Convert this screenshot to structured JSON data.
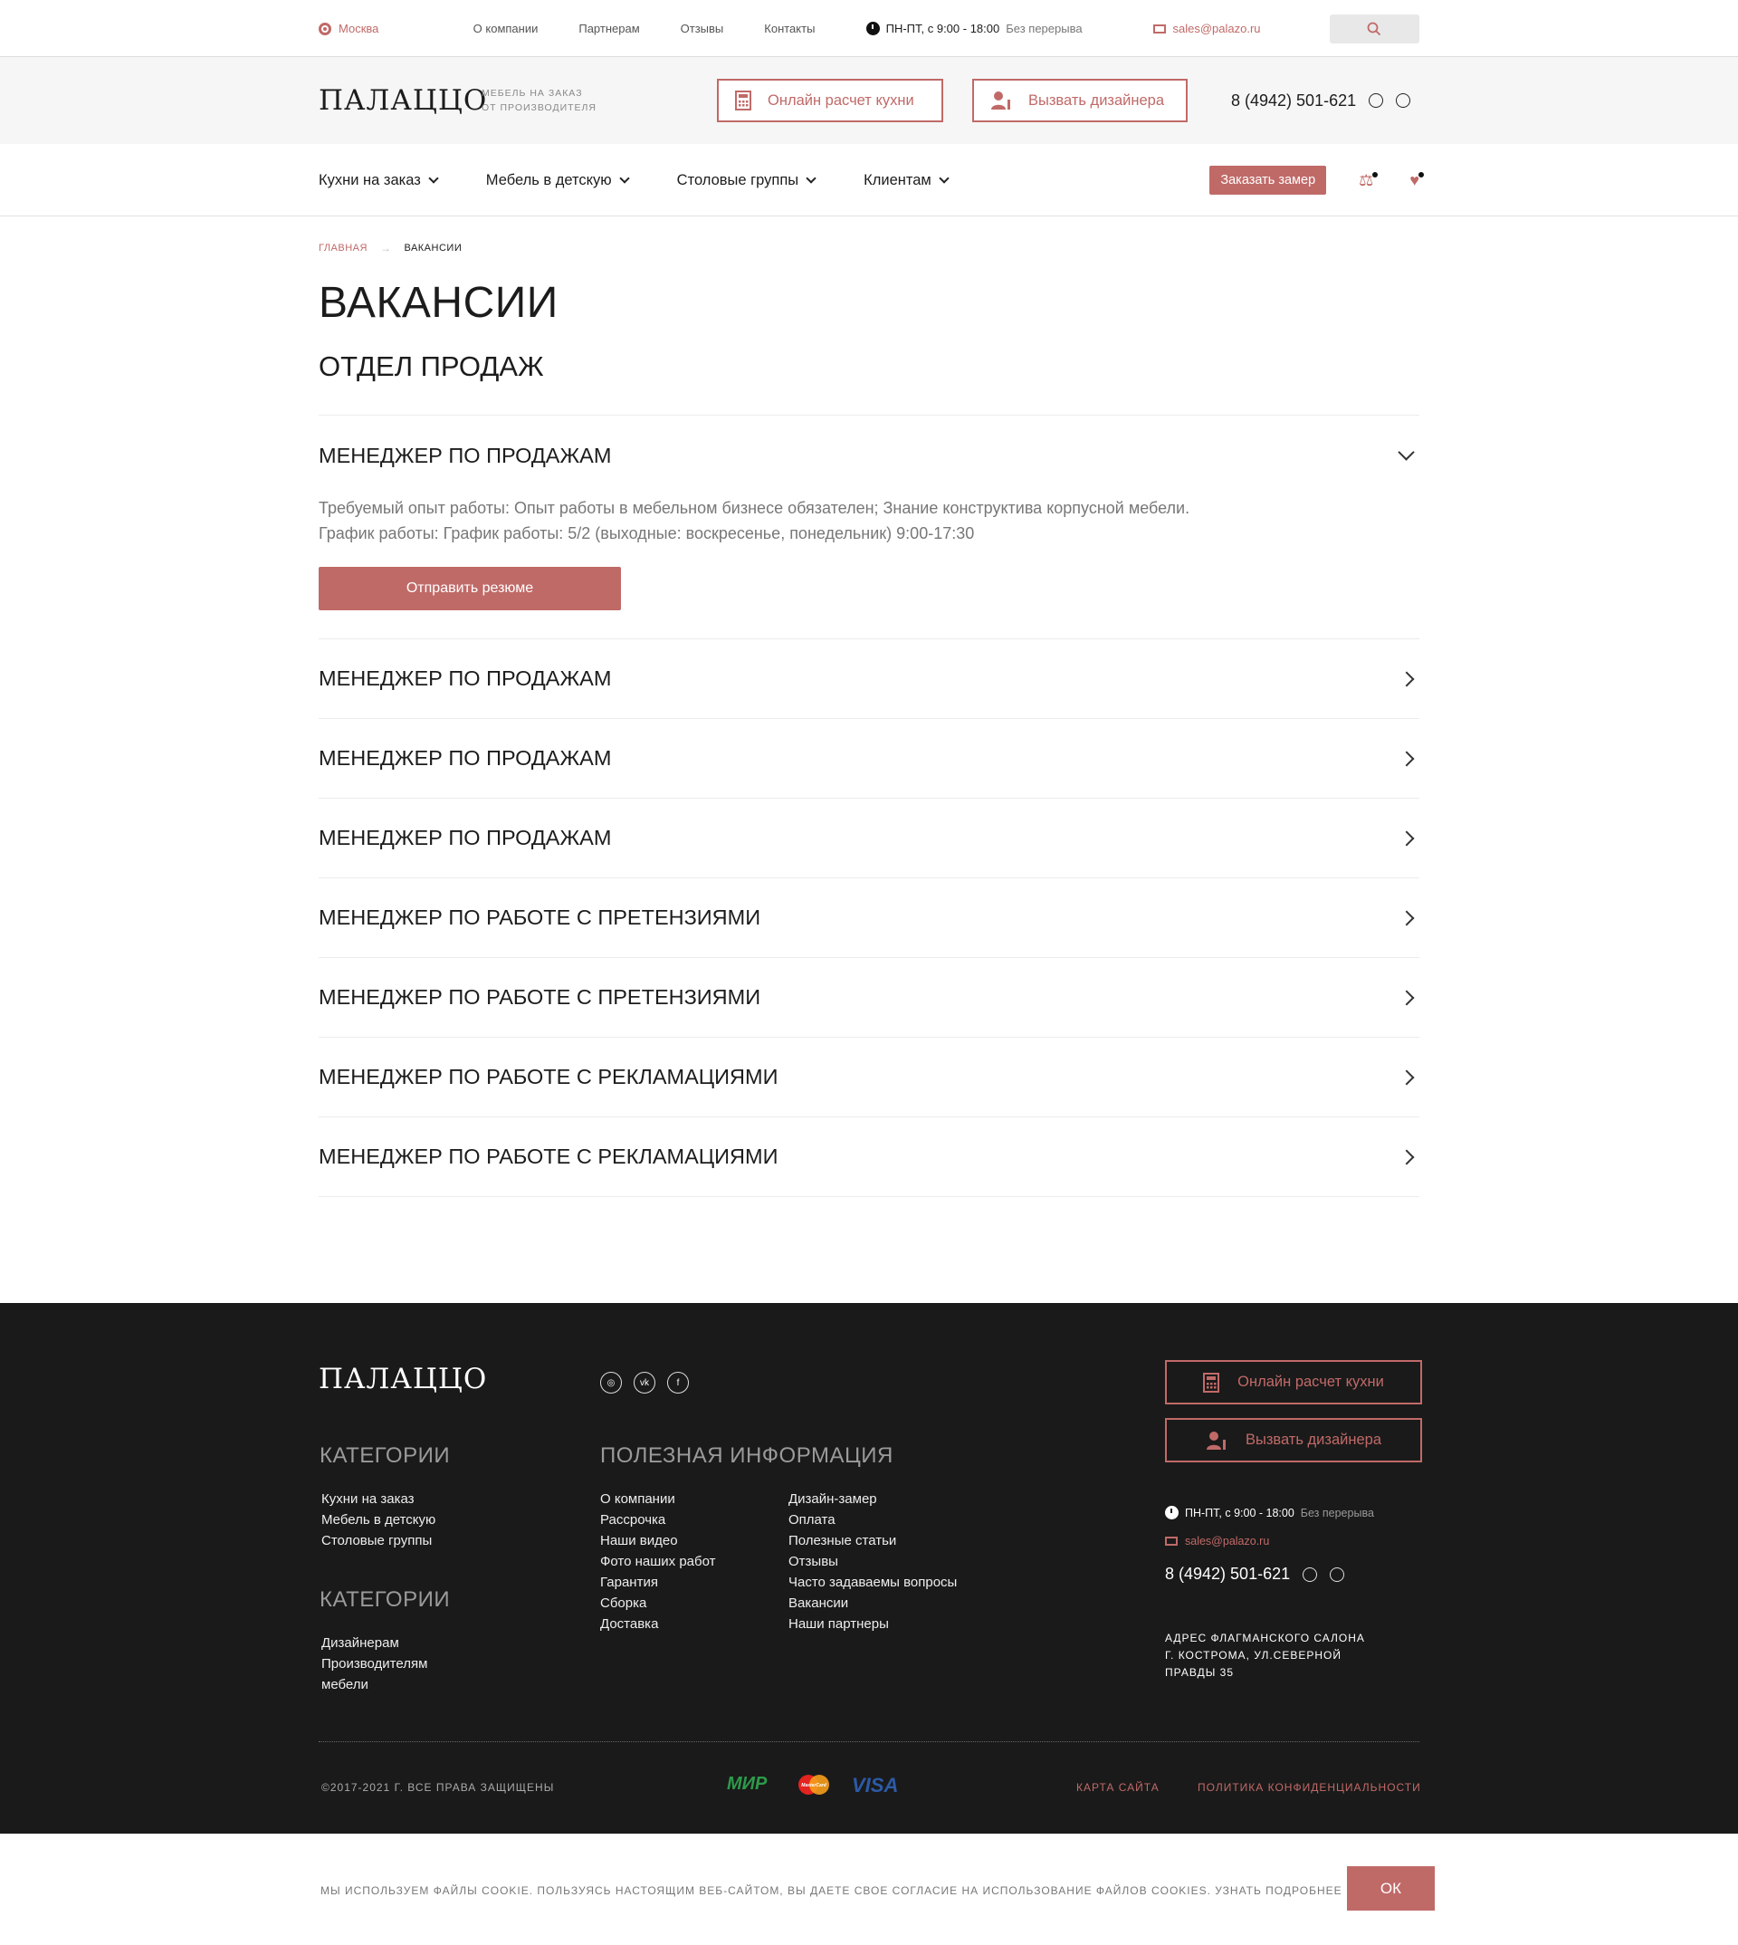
{
  "topbar": {
    "city": "Москва",
    "nav": [
      "О компании",
      "Партнерам",
      "Отзывы",
      "Контакты"
    ],
    "hours": "ПН-ПТ, с 9:00 - 18:00",
    "break": "Без перерыва",
    "email": "sales@palazo.ru"
  },
  "header": {
    "logo": "ПАЛАЦЦО",
    "tagline1": "МЕБЕЛЬ НА ЗАКАЗ",
    "tagline2": "ОТ ПРОИЗВОДИТЕЛЯ",
    "calc_btn": "Онлайн расчет кухни",
    "designer_btn": "Вызвать дизайнера",
    "phone": "8 (4942) 501-621"
  },
  "nav": {
    "items": [
      "Кухни на заказ",
      "Мебель в детскую",
      "Столовые группы",
      "Клиентам"
    ],
    "order_btn": "Заказать замер"
  },
  "breadcrumbs": [
    "ГЛАВНАЯ",
    "ВАКАНСИИ"
  ],
  "page": {
    "title": "ВАКАНСИИ",
    "section": "ОТДЕЛ ПРОДАЖ"
  },
  "vacancies": [
    {
      "title": "МЕНЕДЖЕР ПО ПРОДАЖАМ",
      "expanded": true,
      "experience": "Требуемый опыт работы: Опыт работы в мебельном бизнесе обязателен; Знание конструктива корпусной мебели.",
      "schedule": "График работы: График работы: 5/2 (выходные: воскресенье, понедельник) 9:00-17:30",
      "button": "Отправить резюме"
    },
    {
      "title": "МЕНЕДЖЕР ПО ПРОДАЖАМ"
    },
    {
      "title": "МЕНЕДЖЕР ПО ПРОДАЖАМ"
    },
    {
      "title": "МЕНЕДЖЕР ПО ПРОДАЖАМ"
    },
    {
      "title": "МЕНЕДЖЕР ПО РАБОТЕ С ПРЕТЕНЗИЯМИ"
    },
    {
      "title": "МЕНЕДЖЕР ПО РАБОТЕ С ПРЕТЕНЗИЯМИ"
    },
    {
      "title": "МЕНЕДЖЕР ПО РАБОТЕ С РЕКЛАМАЦИЯМИ"
    },
    {
      "title": "МЕНЕДЖЕР ПО РАБОТЕ С РЕКЛАМАЦИЯМИ"
    }
  ],
  "footer": {
    "logo": "ПАЛАЦЦО",
    "social": [
      "instagram-icon",
      "vk-icon",
      "facebook-icon"
    ],
    "categories_title": "КАТЕГОРИИ",
    "categories": [
      "Кухни на заказ",
      "Мебель в детскую",
      "Столовые группы"
    ],
    "categories2_title": "КАТЕГОРИИ",
    "categories2": [
      "Дизайнерам",
      "Производителям",
      "мебели"
    ],
    "info_title": "ПОЛЕЗНАЯ ИНФОРМАЦИЯ",
    "info_col1": [
      "О компании",
      "Рассрочка",
      "Наши видео",
      "Фото наших работ",
      "Гарантия",
      "Сборка",
      "Доставка"
    ],
    "info_col2": [
      "Дизайн-замер",
      "Оплата",
      "Полезные статьи",
      "Отзывы",
      "Часто задаваемы вопросы",
      "Вакансии",
      "Наши партнеры"
    ],
    "calc_btn": "Онлайн расчет кухни",
    "designer_btn": "Вызвать дизайнера",
    "hours": "ПН-ПТ, с 9:00 - 18:00",
    "break": "Без перерыва",
    "email": "sales@palazo.ru",
    "phone": "8 (4942) 501-621",
    "address": [
      "АДРЕС ФЛАГМАНСКОГО САЛОНА",
      "Г. КОСТРОМА, УЛ.СЕВЕРНОЙ",
      "ПРАВДЫ 35"
    ],
    "copyright": "©2017-2021 Г. ВСЕ ПРАВА ЗАЩИЩЕНЫ",
    "payments": [
      "МИР",
      "MasterCard",
      "VISA"
    ],
    "sitemap": "КАРТА САЙТА",
    "privacy": "ПОЛИТИКА КОНФИДЕНЦИАЛЬНОСТИ"
  },
  "cookie": {
    "text": "МЫ ИСПОЛЬЗУЕМ ФАЙЛЫ COOKIE. ПОЛЬЗУЯСЬ НАСТОЯЩИМ ВЕБ-САЙТОМ, ВЫ ДАЕТЕ СВОЕ СОГЛАСИЕ НА ИСПОЛЬЗОВАНИЕ ФАЙЛОВ COOKIES. УЗНАТЬ ПОДРОБНЕЕ",
    "ok": "ОК"
  },
  "colors": {
    "accent": "#c06a68",
    "footer_bg": "#1a1a1a"
  }
}
